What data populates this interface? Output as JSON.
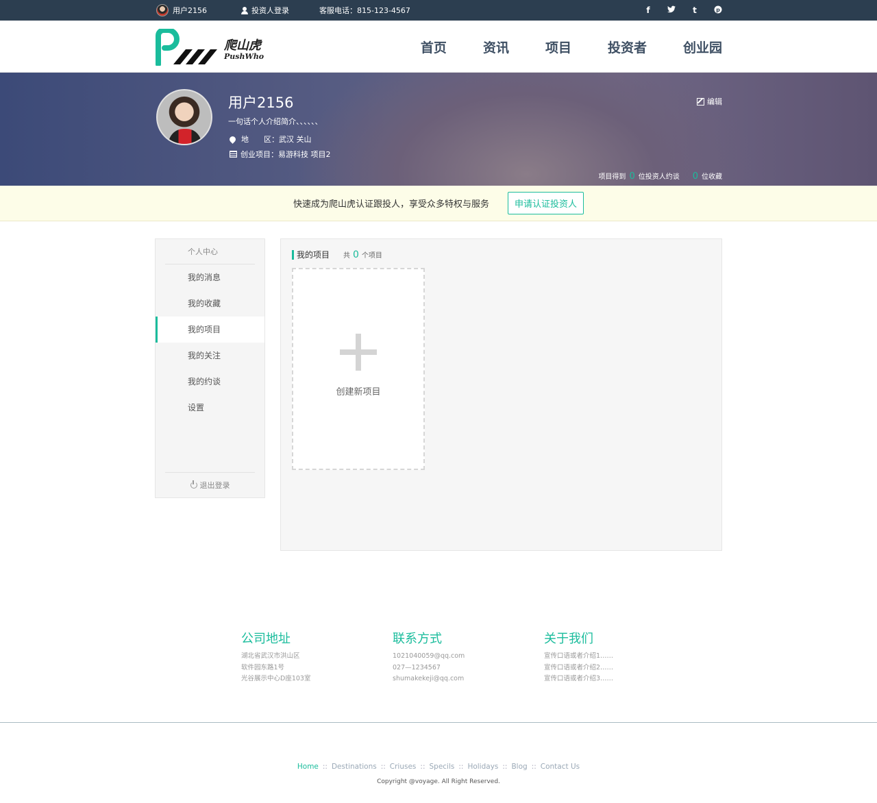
{
  "topbar": {
    "username": "用户2156",
    "investor_login": "投资人登录",
    "phone": "客服电话：815-123-4567",
    "social": [
      "f",
      "t",
      "t",
      "p"
    ]
  },
  "logo": {
    "cn": "爬山虎",
    "en": "PushWho"
  },
  "nav": [
    "首页",
    "资讯",
    "项目",
    "投资者",
    "创业园"
  ],
  "profile": {
    "name": "用户2156",
    "bio": "一句话个人介绍简介、、、、、、",
    "location_label": "地　　区：",
    "location_value": "武汉  关山",
    "project_label": "创业项目：",
    "project_value": "易游科技   项目2",
    "edit": "编辑",
    "stats_prefix": "项目得到",
    "stats_investors": "0",
    "stats_mid": "位投资人约谈",
    "stats_favs": "0",
    "stats_suffix": "位收藏"
  },
  "notice": {
    "text": "快速成为爬山虎认证跟投人，享受众多特权与服务",
    "button": "申请认证投资人"
  },
  "sidebar": {
    "head": "个人中心",
    "items": [
      "我的消息",
      "我的收藏",
      "我的项目",
      "我的关注",
      "我的约谈",
      "设置"
    ],
    "active_index": 2,
    "logout": "退出登录"
  },
  "panel": {
    "title": "我的项目",
    "count_prefix": "共",
    "count": "0",
    "count_suffix": "个项目",
    "create_label": "创建新项目"
  },
  "footer": {
    "cols": [
      {
        "title": "公司地址",
        "lines": [
          "湖北省武汉市洪山区",
          "软件园东路1号",
          "光谷展示中心D座103室"
        ]
      },
      {
        "title": "联系方式",
        "lines": [
          "1021040059@qq.com",
          "027—1234567",
          "shumakekeji@qq.com"
        ]
      },
      {
        "title": "关于我们",
        "lines": [
          "宣传口语或者介绍1……",
          "宣传口语或者介绍2……",
          "宣传口语或者介绍3……"
        ]
      }
    ],
    "links": [
      "Home",
      "Destinations",
      "Criuses",
      "Specils",
      "Holidays",
      "Blog",
      "Contact Us"
    ],
    "copyright": "Copyright @voyage. All Right Reserved."
  },
  "colors": {
    "accent": "#1abc9c",
    "topbar": "#2c3e50",
    "nav_text": "#3e4f63"
  }
}
